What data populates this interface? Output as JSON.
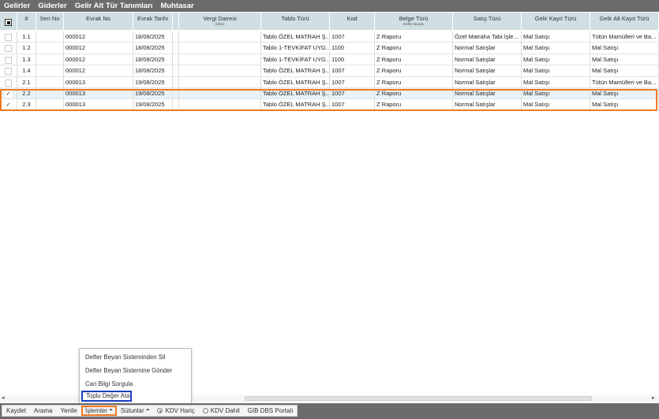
{
  "top_tabs": [
    "Gelirler",
    "Giderler",
    "Gelir Alt Tür Tanımları",
    "Muhtasar"
  ],
  "columns": [
    {
      "label": "",
      "sub": ""
    },
    {
      "label": "#",
      "sub": ""
    },
    {
      "label": "Seri No",
      "sub": ""
    },
    {
      "label": "Evrak No",
      "sub": ""
    },
    {
      "label": "Evrak Tarihi",
      "sub": ""
    },
    {
      "label": "",
      "sub": ""
    },
    {
      "label": "Vergi Dairesi",
      "sub": "(Ülke)"
    },
    {
      "label": "Tablo Türü",
      "sub": ""
    },
    {
      "label": "Kod",
      "sub": ""
    },
    {
      "label": "Belge Türü",
      "sub": "Defter Beyan"
    },
    {
      "label": "Satış Türü",
      "sub": ""
    },
    {
      "label": "Gelir Kayıt Türü",
      "sub": ""
    },
    {
      "label": "Gelir Alt Kayıt Türü",
      "sub": ""
    }
  ],
  "rows": [
    {
      "checked": "",
      "no": "1.1",
      "seri": "",
      "evrak_no": "000012",
      "tarih": "18/08/2025",
      "vd": "",
      "tablo": "Tablo ÖZEL MATRAH Ş...",
      "kod": "1007",
      "belge": "Z Raporu",
      "satis": "Özel Matraha Tabi İşle...",
      "gelir": "Mal Satışı",
      "alt": "Tütün Mamülleri ve Ba..."
    },
    {
      "checked": "",
      "no": "1.2",
      "seri": "",
      "evrak_no": "000012",
      "tarih": "18/08/2025",
      "vd": "",
      "tablo": "Tablo 1-TEVKİFAT UYG...",
      "kod": "1100",
      "belge": "Z Raporu",
      "satis": "Normal Satışlar",
      "gelir": "Mal Satışı",
      "alt": "Mal Satışı"
    },
    {
      "checked": "",
      "no": "1.3",
      "seri": "",
      "evrak_no": "000012",
      "tarih": "18/08/2025",
      "vd": "",
      "tablo": "Tablo 1-TEVKİFAT UYG...",
      "kod": "1100",
      "belge": "Z Raporu",
      "satis": "Normal Satışlar",
      "gelir": "Mal Satışı",
      "alt": "Mal Satışı"
    },
    {
      "checked": "",
      "no": "1.4",
      "seri": "",
      "evrak_no": "000012",
      "tarih": "18/08/2025",
      "vd": "",
      "tablo": "Tablo ÖZEL MATRAH Ş...",
      "kod": "1007",
      "belge": "Z Raporu",
      "satis": "Normal Satışlar",
      "gelir": "Mal Satışı",
      "alt": "Mal Satışı"
    },
    {
      "checked": "",
      "no": "2.1",
      "seri": "",
      "evrak_no": "000013",
      "tarih": "19/08/2025",
      "vd": "",
      "tablo": "Tablo ÖZEL MATRAH Ş...",
      "kod": "1007",
      "belge": "Z Raporu",
      "satis": "Normal Satışlar",
      "gelir": "Mal Satışı",
      "alt": "Tütün Mamülleri ve Ba..."
    },
    {
      "checked": "✓",
      "no": "2.2",
      "seri": "",
      "evrak_no": "000013",
      "tarih": "19/08/2025",
      "vd": "",
      "tablo": "Tablo ÖZEL MATRAH Ş...",
      "kod": "1007",
      "belge": "Z Raporu",
      "satis": "Normal Satışlar",
      "gelir": "Mal Satışı",
      "alt": "Mal Satışı"
    },
    {
      "checked": "✓",
      "no": "2.3",
      "seri": "",
      "evrak_no": "000013",
      "tarih": "19/08/2025",
      "vd": "",
      "tablo": "Tablo ÖZEL MATRAH Ş...",
      "kod": "1007",
      "belge": "Z Raporu",
      "satis": "Normal Satışlar",
      "gelir": "Mal Satışı",
      "alt": "Mal Satışı"
    }
  ],
  "scroll": {
    "left_arrow": "◂",
    "right_arrow": "▸"
  },
  "menu": {
    "items": [
      "Defter Beyan Sisteminden Sil",
      "Defter Beyan Sistemine Gönder",
      "Cari Bilgi Sorgula",
      "Toplu Değer Ata"
    ]
  },
  "bottom": {
    "kaydet": "Kaydet",
    "arama": "Arama",
    "yenile": "Yenile",
    "islemler": "İşlemler",
    "sutunlar": "Sütunlar",
    "caret": "⏶",
    "kdv_haric": "KDV Hariç",
    "kdv_dahil": "KDV Dahil",
    "gib": "GİB DBS Portalı"
  },
  "colors": {
    "header_bg": "#cfdfe3",
    "bar_bg": "#6b6b6b",
    "highlight_orange": "#f07a21",
    "highlight_blue": "#1a3ebf"
  }
}
